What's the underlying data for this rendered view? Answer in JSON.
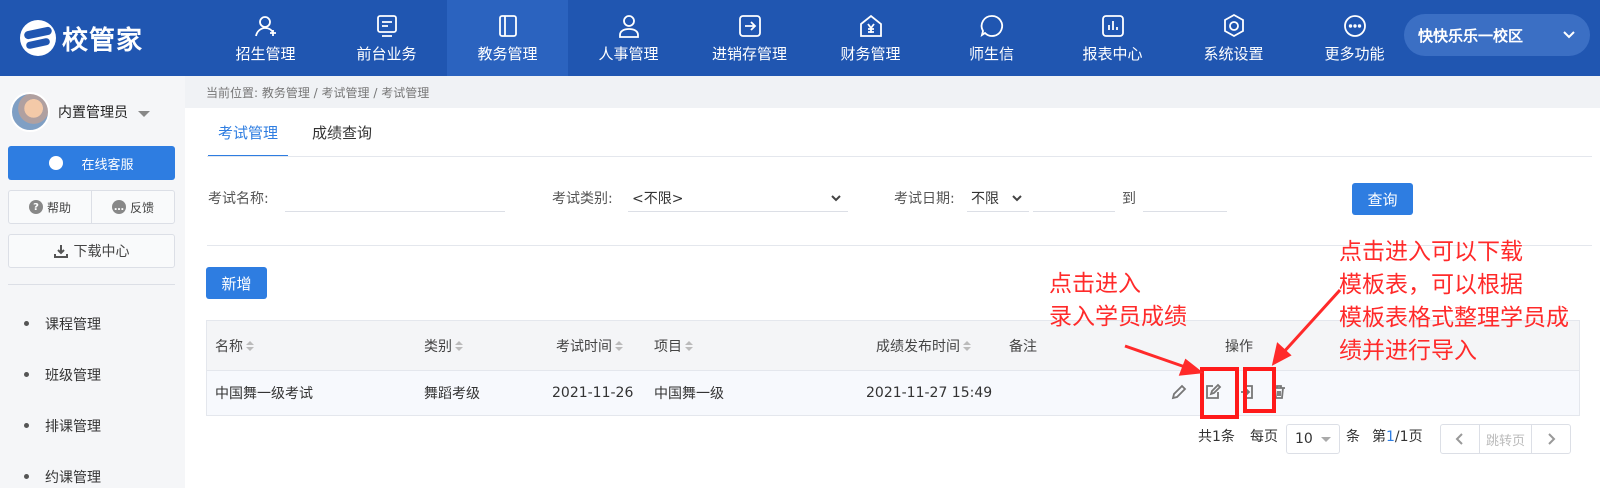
{
  "brand": {
    "name": "校管家"
  },
  "nav": {
    "items": [
      {
        "label": "招生管理",
        "icon": "user-add-icon"
      },
      {
        "label": "前台业务",
        "icon": "monitor-icon"
      },
      {
        "label": "教务管理",
        "icon": "book-icon",
        "active": true
      },
      {
        "label": "人事管理",
        "icon": "person-icon"
      },
      {
        "label": "进销存管理",
        "icon": "box-arrow-icon"
      },
      {
        "label": "财务管理",
        "icon": "yen-house-icon"
      },
      {
        "label": "师生信",
        "icon": "chat-circle-icon"
      },
      {
        "label": "报表中心",
        "icon": "bar-chart-icon"
      },
      {
        "label": "系统设置",
        "icon": "settings-hex-icon"
      },
      {
        "label": "更多功能",
        "icon": "more-dots-icon"
      }
    ],
    "campus": "快快乐乐一校区"
  },
  "sidebar": {
    "user": "内置管理员",
    "service": "在线客服",
    "help": "帮助",
    "feedback": "反馈",
    "download": "下载中心",
    "menu": [
      "课程管理",
      "班级管理",
      "排课管理",
      "约课管理"
    ]
  },
  "breadcrumb": "当前位置: 教务管理 / 考试管理 / 考试管理",
  "tabs": [
    "考试管理",
    "成绩查询"
  ],
  "filters": {
    "name_label": "考试名称:",
    "name_value": "",
    "type_label": "考试类别:",
    "type_value": "<不限>",
    "date_label": "考试日期:",
    "date_value": "不限",
    "to_label": "到",
    "query": "查询"
  },
  "add_button": "新增",
  "table": {
    "headers": [
      "名称",
      "类别",
      "考试时间",
      "项目",
      "成绩发布时间",
      "备注",
      "操作"
    ],
    "rows": [
      {
        "name": "中国舞一级考试",
        "type": "舞蹈考级",
        "date": "2021-11-26",
        "project": "中国舞一级",
        "publish": "2021-11-27 15:49",
        "note": ""
      }
    ]
  },
  "pagination": {
    "total_prefix": "共",
    "total": "1",
    "total_suffix": "条",
    "per_page_label": "每页",
    "per_page": "10",
    "per_page_unit": "条",
    "page_prefix": "第",
    "current": "1",
    "page_sep": "/",
    "pages": "1",
    "page_suffix": "页",
    "jump": "跳转页"
  },
  "annotations": {
    "left": [
      "点击进入",
      "录入学员成绩"
    ],
    "right": [
      "点击进入可以下载",
      "模板表，可以根据",
      "模板表格式整理学员成",
      "绩并进行导入"
    ],
    "color": "#ff2a2a"
  },
  "colors": {
    "nav_bg": "#2056b1",
    "primary": "#2e7de1"
  }
}
